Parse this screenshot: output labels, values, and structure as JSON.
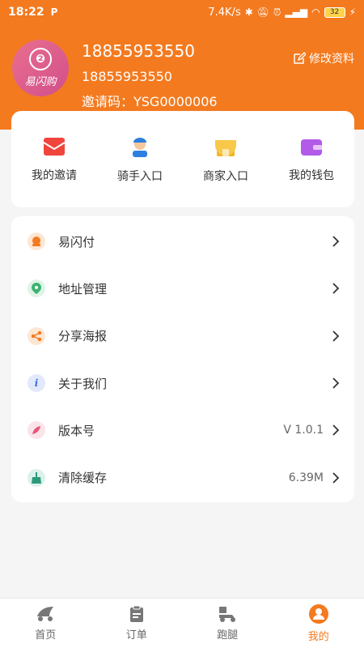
{
  "status_bar": {
    "time": "18:22",
    "speed": "7.4K/s",
    "battery": "32"
  },
  "profile": {
    "logo_text": "易闪购",
    "name": "18855953550",
    "phone": "18855953550",
    "invite_code": "邀请码：YSG0000006",
    "edit_label": "修改资料"
  },
  "quick_actions": [
    {
      "label": "我的邀请",
      "icon": "envelope-icon",
      "color": "#e8423b"
    },
    {
      "label": "骑手入口",
      "icon": "rider-icon",
      "color": "#2d7fe0"
    },
    {
      "label": "商家入口",
      "icon": "shop-icon",
      "color": "#f4b321"
    },
    {
      "label": "我的钱包",
      "icon": "wallet-icon",
      "color": "#b25be8"
    }
  ],
  "menu": [
    {
      "label": "易闪付",
      "value": "",
      "icon": "pay-icon",
      "color": "#f47a1f"
    },
    {
      "label": "地址管理",
      "value": "",
      "icon": "location-icon",
      "color": "#3cb371"
    },
    {
      "label": "分享海报",
      "value": "",
      "icon": "share-icon",
      "color": "#f47a1f"
    },
    {
      "label": "关于我们",
      "value": "",
      "icon": "info-icon",
      "color": "#3d6bd6"
    },
    {
      "label": "版本号",
      "value": "V 1.0.1",
      "icon": "version-icon",
      "color": "#e8567a"
    },
    {
      "label": "清除缓存",
      "value": "6.39M",
      "icon": "broom-icon",
      "color": "#2c9a7a"
    }
  ],
  "tabs": [
    {
      "label": "首页",
      "icon": "home-icon",
      "active": false
    },
    {
      "label": "订单",
      "icon": "order-icon",
      "active": false
    },
    {
      "label": "跑腿",
      "icon": "errand-icon",
      "active": false
    },
    {
      "label": "我的",
      "icon": "profile-icon",
      "active": true
    }
  ]
}
